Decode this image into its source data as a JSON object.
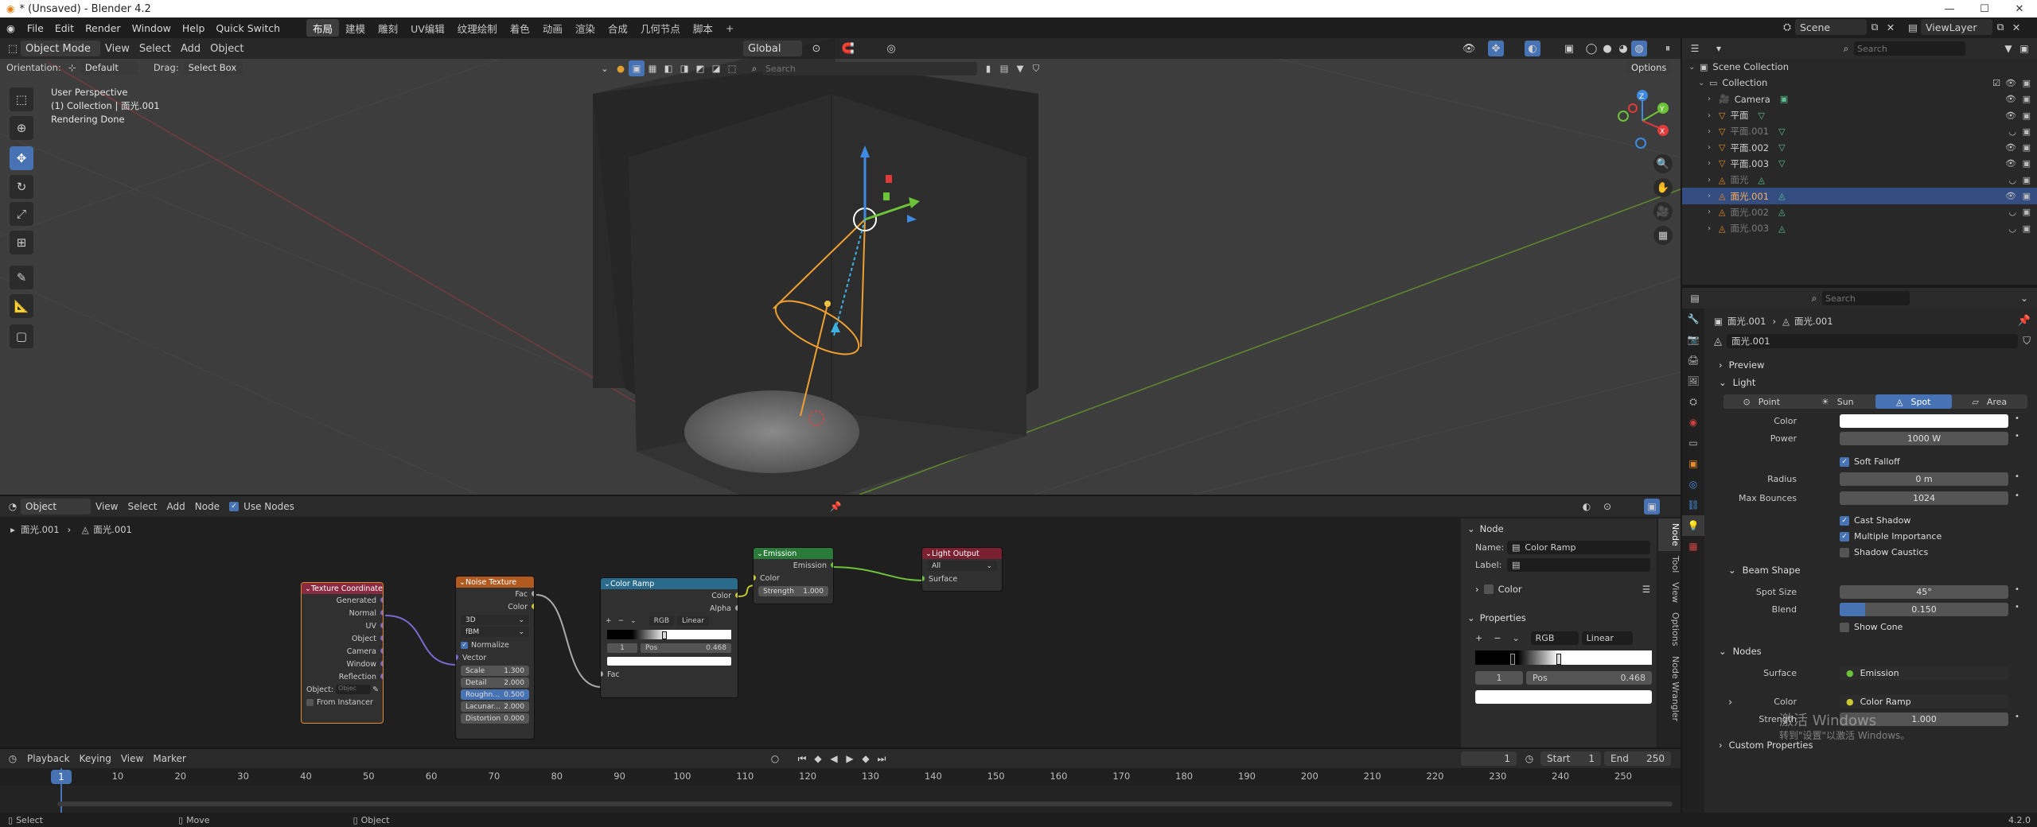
{
  "titlebar": {
    "title": "* (Unsaved) - Blender 4.2",
    "minimize": "—",
    "maximize": "☐",
    "close": "✕"
  },
  "menu": {
    "items": [
      "File",
      "Edit",
      "Render",
      "Window",
      "Help",
      "Quick Switch"
    ],
    "workspaces": [
      "布局",
      "建模",
      "雕刻",
      "UV编辑",
      "纹理绘制",
      "着色",
      "动画",
      "渲染",
      "合成",
      "几何节点",
      "脚本"
    ],
    "add_workspace": "+"
  },
  "viewport": {
    "mode": "Object Mode",
    "menus": [
      "View",
      "Select",
      "Add",
      "Object"
    ],
    "transform_orientation": "Global",
    "orientation_label": "Orientation:",
    "orientation_value": "Default",
    "drag_label": "Drag:",
    "drag_value": "Select Box",
    "options_label": "Options",
    "search_placeholder": "Search",
    "overlay_info": [
      "User Perspective",
      "(1) Collection | 面光.001",
      "Rendering Done"
    ],
    "gizmo_axes": [
      "X",
      "Y",
      "Z"
    ]
  },
  "node_editor": {
    "type_value": "Object",
    "menus": [
      "View",
      "Select",
      "Add",
      "Node"
    ],
    "use_nodes_label": "Use Nodes",
    "breadcrumb": [
      "面光.001",
      "面光.001"
    ],
    "nodes": {
      "texcoord": {
        "title": "Texture Coordinate",
        "outputs": [
          "Generated",
          "Normal",
          "UV",
          "Object",
          "Camera",
          "Window",
          "Reflection"
        ],
        "object_label": "Object:",
        "object_placeholder": "Objec",
        "from_instancer": "From Instancer"
      },
      "noise": {
        "title": "Noise Texture",
        "outputs": [
          "Fac",
          "Color"
        ],
        "dim": "3D",
        "type": "fBM",
        "normalize": "Normalize",
        "vector": "Vector",
        "fields": [
          {
            "label": "Scale",
            "value": "1.300"
          },
          {
            "label": "Detail",
            "value": "2.000"
          },
          {
            "label": "Roughn...",
            "value": "0.500"
          },
          {
            "label": "Lacunar...",
            "value": "2.000"
          },
          {
            "label": "Distortion",
            "value": "0.000"
          }
        ]
      },
      "colorramp": {
        "title": "Color Ramp",
        "outputs": [
          "Color",
          "Alpha"
        ],
        "mode": "RGB",
        "interp": "Linear",
        "index": "1",
        "pos_label": "Pos",
        "pos_value": "0.468",
        "input": "Fac",
        "add": "+",
        "remove": "−",
        "more": "⌄"
      },
      "emission": {
        "title": "Emission",
        "output": "Emission",
        "color": "Color",
        "strength_label": "Strength",
        "strength_value": "1.000"
      },
      "output": {
        "title": "Light Output",
        "target": "All",
        "surface": "Surface"
      }
    },
    "sidebar": {
      "tabs": [
        "Node",
        "Tool",
        "View",
        "Options",
        "Node Wrangler"
      ],
      "node_section": "Node",
      "name_label": "Name:",
      "name_value": "Color Ramp",
      "label_label": "Label:",
      "label_value": "",
      "color_section": "Color",
      "properties_section": "Properties",
      "mode": "RGB",
      "interp": "Linear",
      "index": "1",
      "pos_label": "Pos",
      "pos_value": "0.468"
    }
  },
  "timeline": {
    "menus": [
      "Playback",
      "Keying",
      "View",
      "Marker"
    ],
    "current_frame": "1",
    "start_label": "Start",
    "start_value": "1",
    "end_label": "End",
    "end_value": "250",
    "ticks": [
      "1",
      "10",
      "20",
      "30",
      "40",
      "50",
      "60",
      "70",
      "80",
      "90",
      "100",
      "110",
      "120",
      "130",
      "140",
      "150",
      "160",
      "170",
      "180",
      "190",
      "200",
      "210",
      "220",
      "230",
      "240",
      "250"
    ]
  },
  "statusbar": {
    "items": [
      "Select",
      "Move",
      "Object"
    ],
    "version": "4.2.0"
  },
  "outliner": {
    "scene_label": "Scene",
    "viewlayer_label": "ViewLayer",
    "search_placeholder": "Search",
    "rows": [
      {
        "name": "Scene Collection",
        "indent": 0,
        "kind": "scene"
      },
      {
        "name": "Collection",
        "indent": 1,
        "kind": "collection"
      },
      {
        "name": "Camera",
        "indent": 2,
        "kind": "camera"
      },
      {
        "name": "平面",
        "indent": 2,
        "kind": "mesh"
      },
      {
        "name": "平面.001",
        "indent": 2,
        "kind": "mesh",
        "dim": true
      },
      {
        "name": "平面.002",
        "indent": 2,
        "kind": "mesh"
      },
      {
        "name": "平面.003",
        "indent": 2,
        "kind": "mesh"
      },
      {
        "name": "面光",
        "indent": 2,
        "kind": "light",
        "dim": true
      },
      {
        "name": "面光.001",
        "indent": 2,
        "kind": "light",
        "selected": true
      },
      {
        "name": "面光.002",
        "indent": 2,
        "kind": "light",
        "dim": true
      },
      {
        "name": "面光.003",
        "indent": 2,
        "kind": "light",
        "dim": true
      }
    ]
  },
  "properties": {
    "search_placeholder": "Search",
    "breadcrumb": [
      "面光.001",
      "面光.001"
    ],
    "datablock": "面光.001",
    "preview_section": "Preview",
    "light_section": "Light",
    "light_types": [
      "Point",
      "Sun",
      "Spot",
      "Area"
    ],
    "active_type": "Spot",
    "color_label": "Color",
    "power_label": "Power",
    "power_value": "1000 W",
    "soft_falloff": "Soft Falloff",
    "radius_label": "Radius",
    "radius_value": "0 m",
    "max_bounces_label": "Max Bounces",
    "max_bounces_value": "1024",
    "cast_shadow": "Cast Shadow",
    "multiple_importance": "Multiple Importance",
    "shadow_caustics": "Shadow Caustics",
    "beam_section": "Beam Shape",
    "spot_size_label": "Spot Size",
    "spot_size_value": "45°",
    "blend_label": "Blend",
    "blend_value": "0.150",
    "blend_fraction": 0.15,
    "show_cone": "Show Cone",
    "nodes_section": "Nodes",
    "surface_label": "Surface",
    "surface_value": "Emission",
    "color_node_label": "Color",
    "color_node_value": "Color Ramp",
    "strength_label": "Strength",
    "strength_value": "1.000",
    "custom_props": "Custom Properties",
    "watermark_1": "激活 Windows",
    "watermark_2": "转到\"设置\"以激活 Windows。"
  },
  "colors": {
    "accent": "#4772b3",
    "header": "#2a2a2a",
    "selected_row": "#334d80",
    "viewport_bg": "#3d3d3d"
  }
}
